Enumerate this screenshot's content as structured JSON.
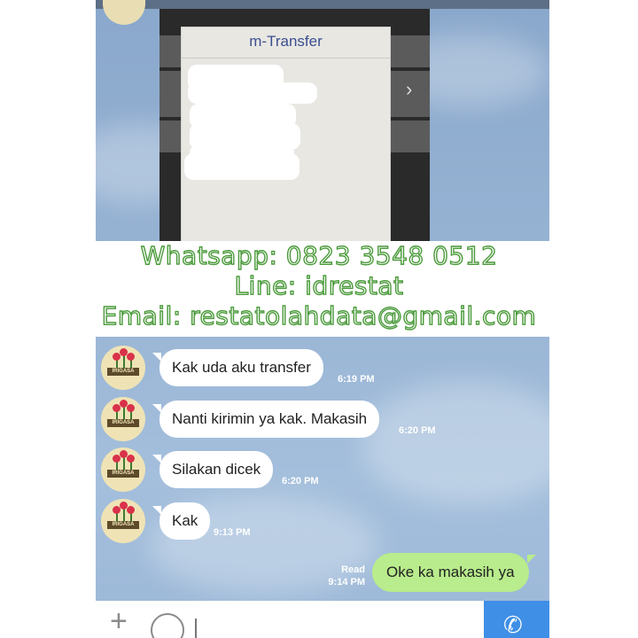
{
  "photo": {
    "dialog_title": "m-Transfer"
  },
  "banner": {
    "line1": "Whatsapp: 0823 3548 0512",
    "line2": "Line: idrestat",
    "line3": "Email: restatolahdata@gmail.com"
  },
  "avatar": {
    "label": "IRIGASA"
  },
  "messages": [
    {
      "text": "Kak uda aku transfer",
      "time": "6:19 PM"
    },
    {
      "text": "Nanti kirimin ya kak. Makasih",
      "time": "6:20 PM"
    },
    {
      "text": "Silakan dicek",
      "time": "6:20 PM"
    },
    {
      "text": "Kak",
      "time": "9:13 PM"
    }
  ],
  "sent": {
    "text": "Oke ka makasih ya",
    "status": "Read",
    "time": "9:14 PM"
  },
  "colors": {
    "chat_bg": "#98b4d4",
    "sent_bubble": "#b8ec8c",
    "banner_text_outline": "#4a9a3a",
    "call_button": "#3f8fe6"
  },
  "icons": [
    "plus-icon",
    "emoji-icon",
    "phone-icon",
    "chevron-right-icon"
  ]
}
